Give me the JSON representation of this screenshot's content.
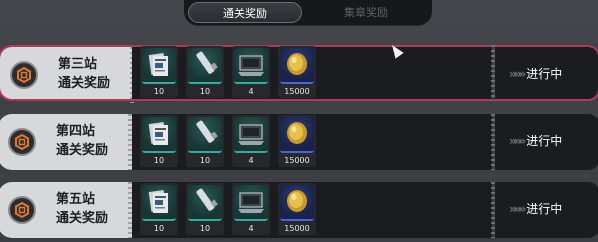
{
  "tabs": [
    {
      "label": "通关奖励",
      "active": true
    },
    {
      "label": "集章奖励",
      "active": false
    }
  ],
  "rows": [
    {
      "station": "第三站",
      "subtitle": "通关奖励",
      "status": "进行中",
      "status_arrows": "»»»",
      "active": true,
      "items": [
        {
          "icon": "document-icon",
          "qty": "10"
        },
        {
          "icon": "tube-icon",
          "qty": "10"
        },
        {
          "icon": "laptop-icon",
          "qty": "4"
        },
        {
          "icon": "gold-coin-icon",
          "qty": "15000"
        }
      ]
    },
    {
      "station": "第四站",
      "subtitle": "通关奖励",
      "status": "进行中",
      "status_arrows": "»»»",
      "active": false,
      "items": [
        {
          "icon": "document-icon",
          "qty": "10"
        },
        {
          "icon": "tube-icon",
          "qty": "10"
        },
        {
          "icon": "laptop-icon",
          "qty": "4"
        },
        {
          "icon": "gold-coin-icon",
          "qty": "15000"
        }
      ]
    },
    {
      "station": "第五站",
      "subtitle": "通关奖励",
      "status": "进行中",
      "status_arrows": "»»»",
      "active": false,
      "items": [
        {
          "icon": "document-icon",
          "qty": "10"
        },
        {
          "icon": "tube-icon",
          "qty": "10"
        },
        {
          "icon": "laptop-icon",
          "qty": "4"
        },
        {
          "icon": "gold-coin-icon",
          "qty": "15000"
        }
      ]
    }
  ],
  "colors": {
    "active_border": "#b8365e",
    "teal_rarity": "#2fae9c",
    "blue_rarity": "#4a66d9"
  }
}
